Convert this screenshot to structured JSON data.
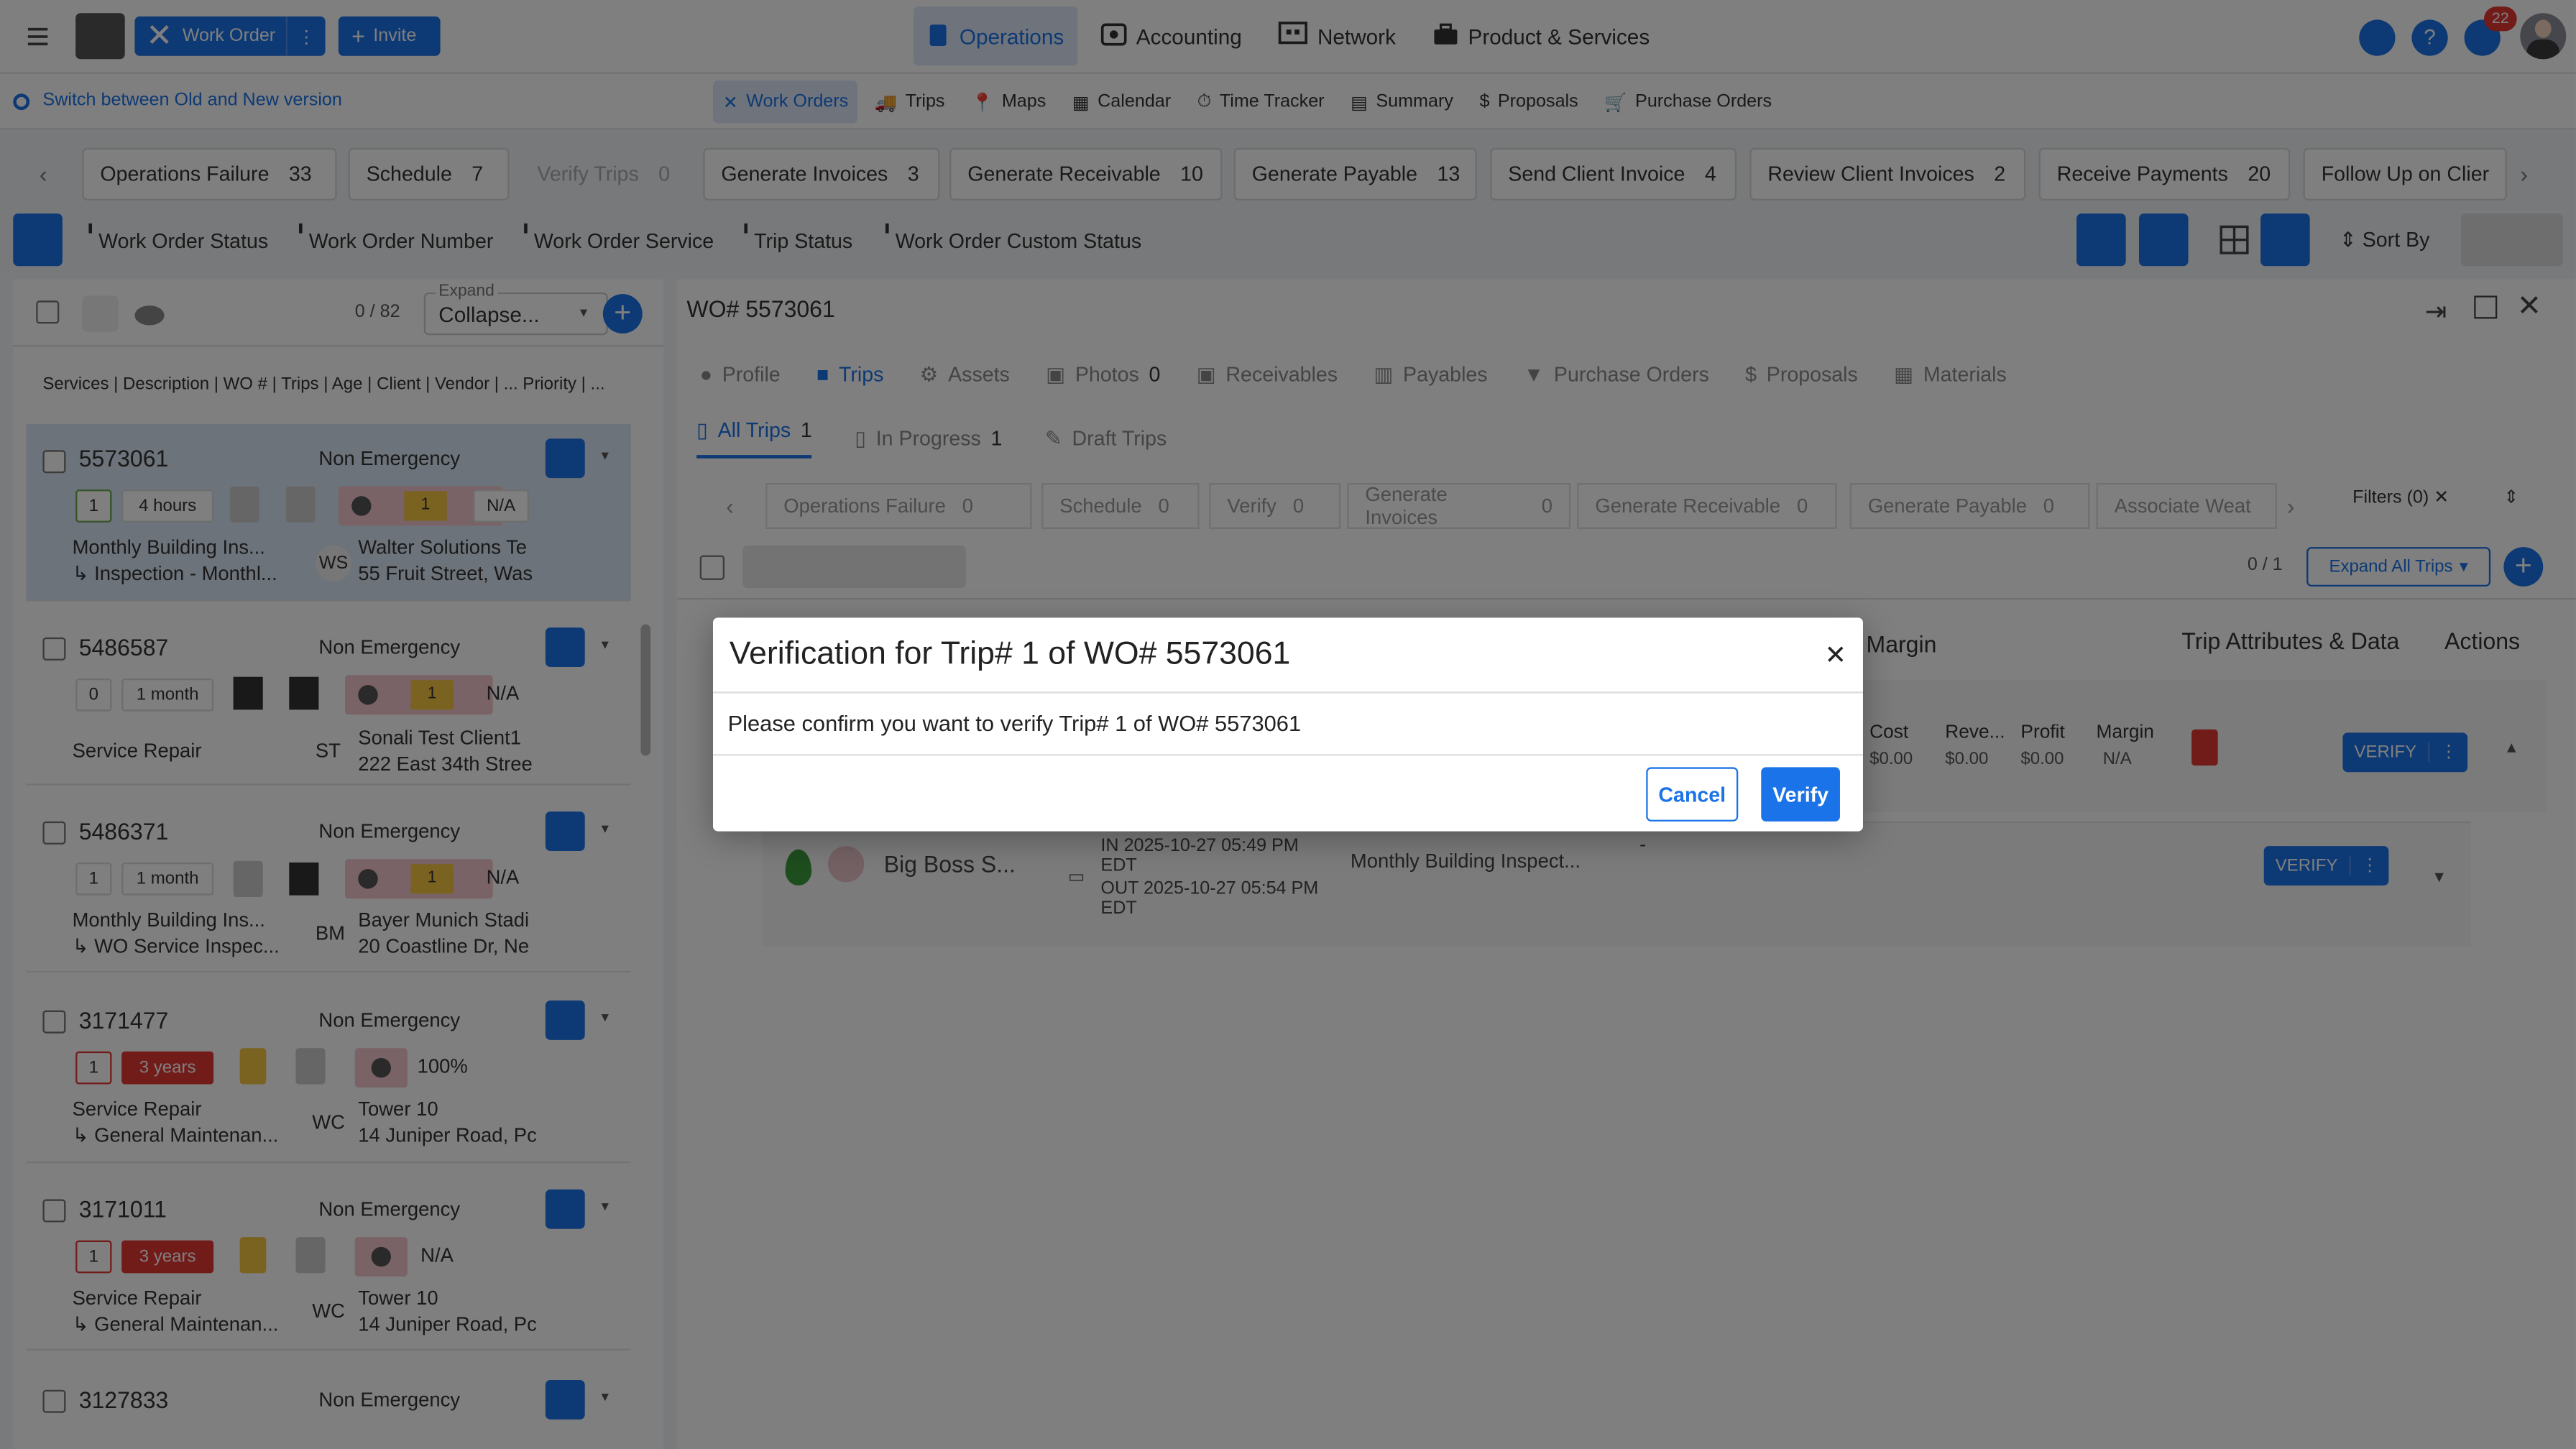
{
  "topbar": {
    "work_order_label": "Work Order",
    "invite_label": "Invite",
    "nav": [
      "Operations",
      "Accounting",
      "Network",
      "Product & Services"
    ],
    "notif_count": "22"
  },
  "subnav": {
    "switch_label": "Switch between Old and New version",
    "items": [
      "Work Orders",
      "Trips",
      "Maps",
      "Calendar",
      "Time Tracker",
      "Summary",
      "Proposals",
      "Purchase Orders"
    ]
  },
  "steps": [
    {
      "label": "Operations Failure",
      "count": "33"
    },
    {
      "label": "Schedule",
      "count": "7"
    },
    {
      "label": "Verify Trips",
      "count": "0"
    },
    {
      "label": "Generate Invoices",
      "count": "3"
    },
    {
      "label": "Generate Receivable",
      "count": "10"
    },
    {
      "label": "Generate Payable",
      "count": "13"
    },
    {
      "label": "Send Client Invoice",
      "count": "4"
    },
    {
      "label": "Review Client Invoices",
      "count": "2"
    },
    {
      "label": "Receive Payments",
      "count": "20"
    },
    {
      "label": "Follow Up on Clier",
      "count": ""
    }
  ],
  "filters": [
    "Work Order Status",
    "Work Order Number",
    "Work Order Service",
    "Trip Status",
    "Work Order Custom Status"
  ],
  "sort_label": "Sort By",
  "list": {
    "count": "0 / 82",
    "expand_label": "Expand",
    "expand_value": "Collapse...",
    "columns": "Services | Description | WO # | Trips | Age | Client | Vendor | ... Priority | ...",
    "items": [
      {
        "wo": "5573061",
        "priority": "Non Emergency",
        "trips": "1",
        "age": "4 hours",
        "badge": "1",
        "pct": "N/A",
        "desc1": "Monthly Building Ins...",
        "desc2": "↳ Inspection - Monthl...",
        "initials": "WS",
        "client": "Walter Solutions Te",
        "addr": "55 Fruit Street, Was"
      },
      {
        "wo": "5486587",
        "priority": "Non Emergency",
        "trips": "0",
        "age": "1 month",
        "badge": "1",
        "pct": "N/A",
        "desc1": "Service Repair",
        "desc2": "",
        "initials": "ST",
        "client": "Sonali Test Client1",
        "addr": "222 East 34th Stree"
      },
      {
        "wo": "5486371",
        "priority": "Non Emergency",
        "trips": "1",
        "age": "1 month",
        "badge": "1",
        "pct": "N/A",
        "desc1": "Monthly Building Ins...",
        "desc2": "↳ WO Service Inspec...",
        "initials": "BM",
        "client": "Bayer Munich Stadi",
        "addr": "20 Coastline Dr, Ne"
      },
      {
        "wo": "3171477",
        "priority": "Non Emergency",
        "trips": "1",
        "age": "3 years",
        "badge": "",
        "pct": "100%",
        "desc1": "Service Repair",
        "desc2": "↳ General Maintenan...",
        "initials": "WC",
        "client": "Tower 10",
        "addr": "14 Juniper Road, Pc"
      },
      {
        "wo": "3171011",
        "priority": "Non Emergency",
        "trips": "1",
        "age": "3 years",
        "badge": "",
        "pct": "N/A",
        "desc1": "Service Repair",
        "desc2": "↳ General Maintenan...",
        "initials": "WC",
        "client": "Tower 10",
        "addr": "14 Juniper Road, Pc"
      },
      {
        "wo": "3127833",
        "priority": "Non Emergency",
        "trips": "",
        "age": "",
        "badge": "",
        "pct": "",
        "desc1": "",
        "desc2": "",
        "initials": "",
        "client": "",
        "addr": ""
      }
    ]
  },
  "detail": {
    "title": "WO# 5573061",
    "tabs": [
      "Profile",
      "Trips",
      "Assets",
      "Photos",
      "Receivables",
      "Payables",
      "Purchase Orders",
      "Proposals",
      "Materials"
    ],
    "photos_count": "0",
    "subtabs": [
      {
        "label": "All Trips",
        "count": "1"
      },
      {
        "label": "In Progress",
        "count": "1"
      },
      {
        "label": "Draft Trips",
        "count": ""
      }
    ],
    "trip_steps": [
      {
        "label": "Operations Failure",
        "count": "0"
      },
      {
        "label": "Schedule",
        "count": "0"
      },
      {
        "label": "Verify",
        "count": "0"
      },
      {
        "label": "Generate Invoices",
        "count": "0"
      },
      {
        "label": "Generate Receivable",
        "count": "0"
      },
      {
        "label": "Generate Payable",
        "count": "0"
      },
      {
        "label": "Associate Weat",
        "count": ""
      }
    ],
    "filters_label": "Filters (0)",
    "trip_count": "0 / 1",
    "expand_all": "Expand All Trips",
    "col_margin": "Margin",
    "col_attrs": "Trip Attributes & Data",
    "col_actions": "Actions",
    "fin": [
      {
        "label": "Cost",
        "value": "$0.00"
      },
      {
        "label": "Reve...",
        "value": "$0.00"
      },
      {
        "label": "Profit",
        "value": "$0.00"
      },
      {
        "label": "Margin",
        "value": "N/A"
      }
    ],
    "verify_label": "VERIFY",
    "tech": "Big Boss S...",
    "check_in": "IN 2025-10-27 05:49 PM EDT",
    "check_out": "OUT 2025-10-27 05:54 PM EDT",
    "service": "Monthly Building Inspect...",
    "dash": "-"
  },
  "modal": {
    "title": "Verification for Trip# 1 of WO# 5573061",
    "message": "Please confirm you want to verify Trip# 1 of WO# 5573061",
    "cancel_label": "Cancel",
    "verify_label": "Verify"
  }
}
